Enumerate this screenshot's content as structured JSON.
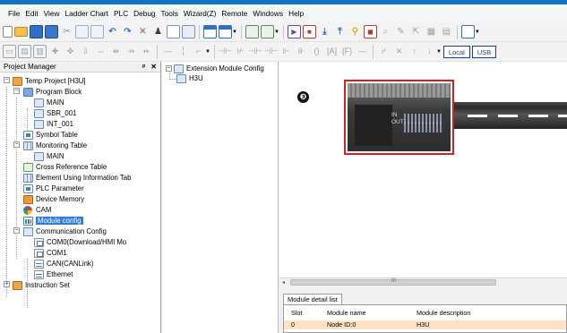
{
  "menu": [
    "File",
    "Edit",
    "View",
    "Ladder Chart",
    "PLC",
    "Debug",
    "Tools",
    "Wizard(Z)",
    "Remote",
    "Windows",
    "Help"
  ],
  "toolbar2": {
    "local_label": "Local",
    "usb_label": "USB"
  },
  "project_manager": {
    "title": "Project Manager",
    "pin_glyph": "ᵖ",
    "close_glyph": "✕",
    "tree": {
      "project": "Temp Project [H3U]",
      "program_block": "Program Block",
      "main": "MAIN",
      "sbr": "SBR_001",
      "int": "INT_001",
      "symbol_table": "Symbol Table",
      "monitoring_table": "Monitoring Table",
      "monitoring_main": "MAIN",
      "cross_ref": "Cross Reference Table",
      "element_info": "Element Using Information Tab",
      "plc_param": "PLC Parameter",
      "device_memory": "Device Memory",
      "cam": "CAM",
      "module_config": "Module config",
      "comm_config": "Communication Config",
      "com0": "COM0(Download/HMI Mo",
      "com1": "COM1",
      "can": "CAN(CANLink)",
      "ethernet": "Ethernet",
      "instruction_set": "Instruction Set"
    }
  },
  "ext_module": {
    "root": "Extension Module Config",
    "child": "H3U"
  },
  "canvas": {
    "badge": "❸",
    "module_in": "IN",
    "module_out": "OUT"
  },
  "scroll": {
    "left_arrow": "◂",
    "grip": "III"
  },
  "module_detail": {
    "tab": "Module detail list",
    "columns": [
      "Slot",
      "Module name",
      "Module description"
    ],
    "rows": [
      [
        "0",
        "Node ID:0",
        "H3U"
      ]
    ]
  },
  "colors": {
    "selection": "#2f7de1",
    "highlight_row": "#fde3c4",
    "module_border": "#e01b1b"
  }
}
